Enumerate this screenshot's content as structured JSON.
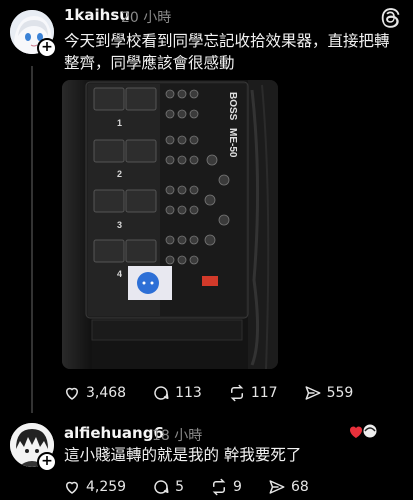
{
  "post1": {
    "username": "1kaihsu",
    "time": "20 小時",
    "text": "今天到學校看到同學忘記收拾效果器，直接把轉整齊，同學應該會很感動",
    "photo": {
      "brand": "BOSS",
      "model": "ME-50",
      "pedal_numbers": [
        "1",
        "2",
        "3",
        "4"
      ]
    },
    "actions": {
      "likes": "3,468",
      "comments": "113",
      "reposts": "117",
      "shares": "559"
    }
  },
  "post2": {
    "username": "alfiehuang6",
    "time": "18 小時",
    "text": "這小賤逼轉的就是我的 幹我要死了",
    "actions": {
      "likes": "4,259",
      "comments": "5",
      "reposts": "9",
      "shares": "68"
    }
  },
  "colors": {
    "background": "#000000",
    "text": "#f2f2f2",
    "muted": "#8a8a8a",
    "heart_red": "#e8303b"
  },
  "icons": [
    "threads-logo-icon",
    "heart-icon",
    "comment-icon",
    "repost-icon",
    "share-icon",
    "plus-icon"
  ]
}
